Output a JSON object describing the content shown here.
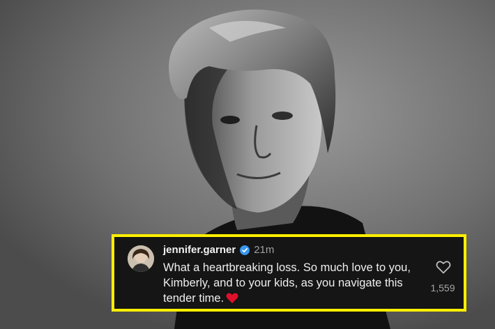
{
  "photo": {
    "icon": "portrait-photo-black-and-white"
  },
  "comment": {
    "username": "jennifer.garner",
    "verified_icon": "verified-badge-icon",
    "timestamp": "21m",
    "text": "What a heartbreaking loss. So much love to you, Kimberly, and to your kids, as you navigate this tender time.",
    "emoji_icon": "red-heart-emoji-icon",
    "like_icon": "heart-outline-icon",
    "like_count": "1,559",
    "highlight_color": "#ffef00",
    "verified_color": "#3897f0",
    "emoji_color": "#e0102a"
  }
}
